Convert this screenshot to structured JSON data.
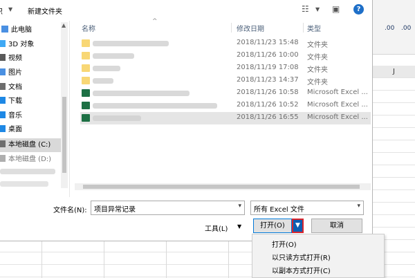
{
  "toolbar": {
    "organize_partial": "组织",
    "new_folder": "新建文件夹",
    "help": "?"
  },
  "nav": {
    "items": [
      {
        "label": "此电脑",
        "icon": "computer-icon",
        "color": "#4a90e2"
      },
      {
        "label": "3D 对象",
        "icon": "cube-icon",
        "color": "#3fa9f5"
      },
      {
        "label": "视频",
        "icon": "video-icon",
        "color": "#5a5a5a"
      },
      {
        "label": "图片",
        "icon": "picture-icon",
        "color": "#4a90e2"
      },
      {
        "label": "文档",
        "icon": "document-icon",
        "color": "#6d6d6d"
      },
      {
        "label": "下载",
        "icon": "download-icon",
        "color": "#1e88e5"
      },
      {
        "label": "音乐",
        "icon": "music-icon",
        "color": "#1e88e5"
      },
      {
        "label": "桌面",
        "icon": "desktop-icon",
        "color": "#1e88e5"
      },
      {
        "label": "本地磁盘 (C:)",
        "icon": "drive-icon",
        "color": "#6d6d6d"
      },
      {
        "label": "本地磁盘 (D:)",
        "icon": "drive-icon",
        "color": "#6d6d6d"
      }
    ]
  },
  "columns": {
    "name": "名称",
    "modified": "修改日期",
    "type": "类型"
  },
  "files": [
    {
      "date": "2018/11/23 15:48",
      "type": "文件夹",
      "icon": "folder-icon"
    },
    {
      "date": "2018/11/26 10:00",
      "type": "文件夹",
      "icon": "folder-icon"
    },
    {
      "date": "2018/11/19 17:08",
      "type": "文件夹",
      "icon": "folder-icon"
    },
    {
      "date": "2018/11/23 14:37",
      "type": "文件夹",
      "icon": "folder-icon"
    },
    {
      "date": "2018/11/26 10:58",
      "type": "Microsoft Excel ...",
      "icon": "excel-icon"
    },
    {
      "date": "2018/11/26 10:52",
      "type": "Microsoft Excel ...",
      "icon": "excel-icon"
    },
    {
      "date": "2018/11/26 16:55",
      "type": "Microsoft Excel ...",
      "icon": "excel-icon"
    }
  ],
  "filename": {
    "label": "文件名(N):",
    "value": "项目异常记录"
  },
  "filetype": {
    "value": "所有 Excel 文件"
  },
  "buttons": {
    "tools": "工具(L)",
    "open": "打开(O)",
    "cancel": "取消"
  },
  "open_menu": {
    "items": [
      "打开(O)",
      "以只读方式打开(R)",
      "以副本方式打开(C)"
    ]
  },
  "excel": {
    "column_letter": "J",
    "format_buttons": [
      ".00",
      ".00"
    ]
  },
  "colors": {
    "accent": "#0078d7",
    "highlight": "#d9242b",
    "folder": "#f8d775",
    "excel": "#1d7044"
  }
}
